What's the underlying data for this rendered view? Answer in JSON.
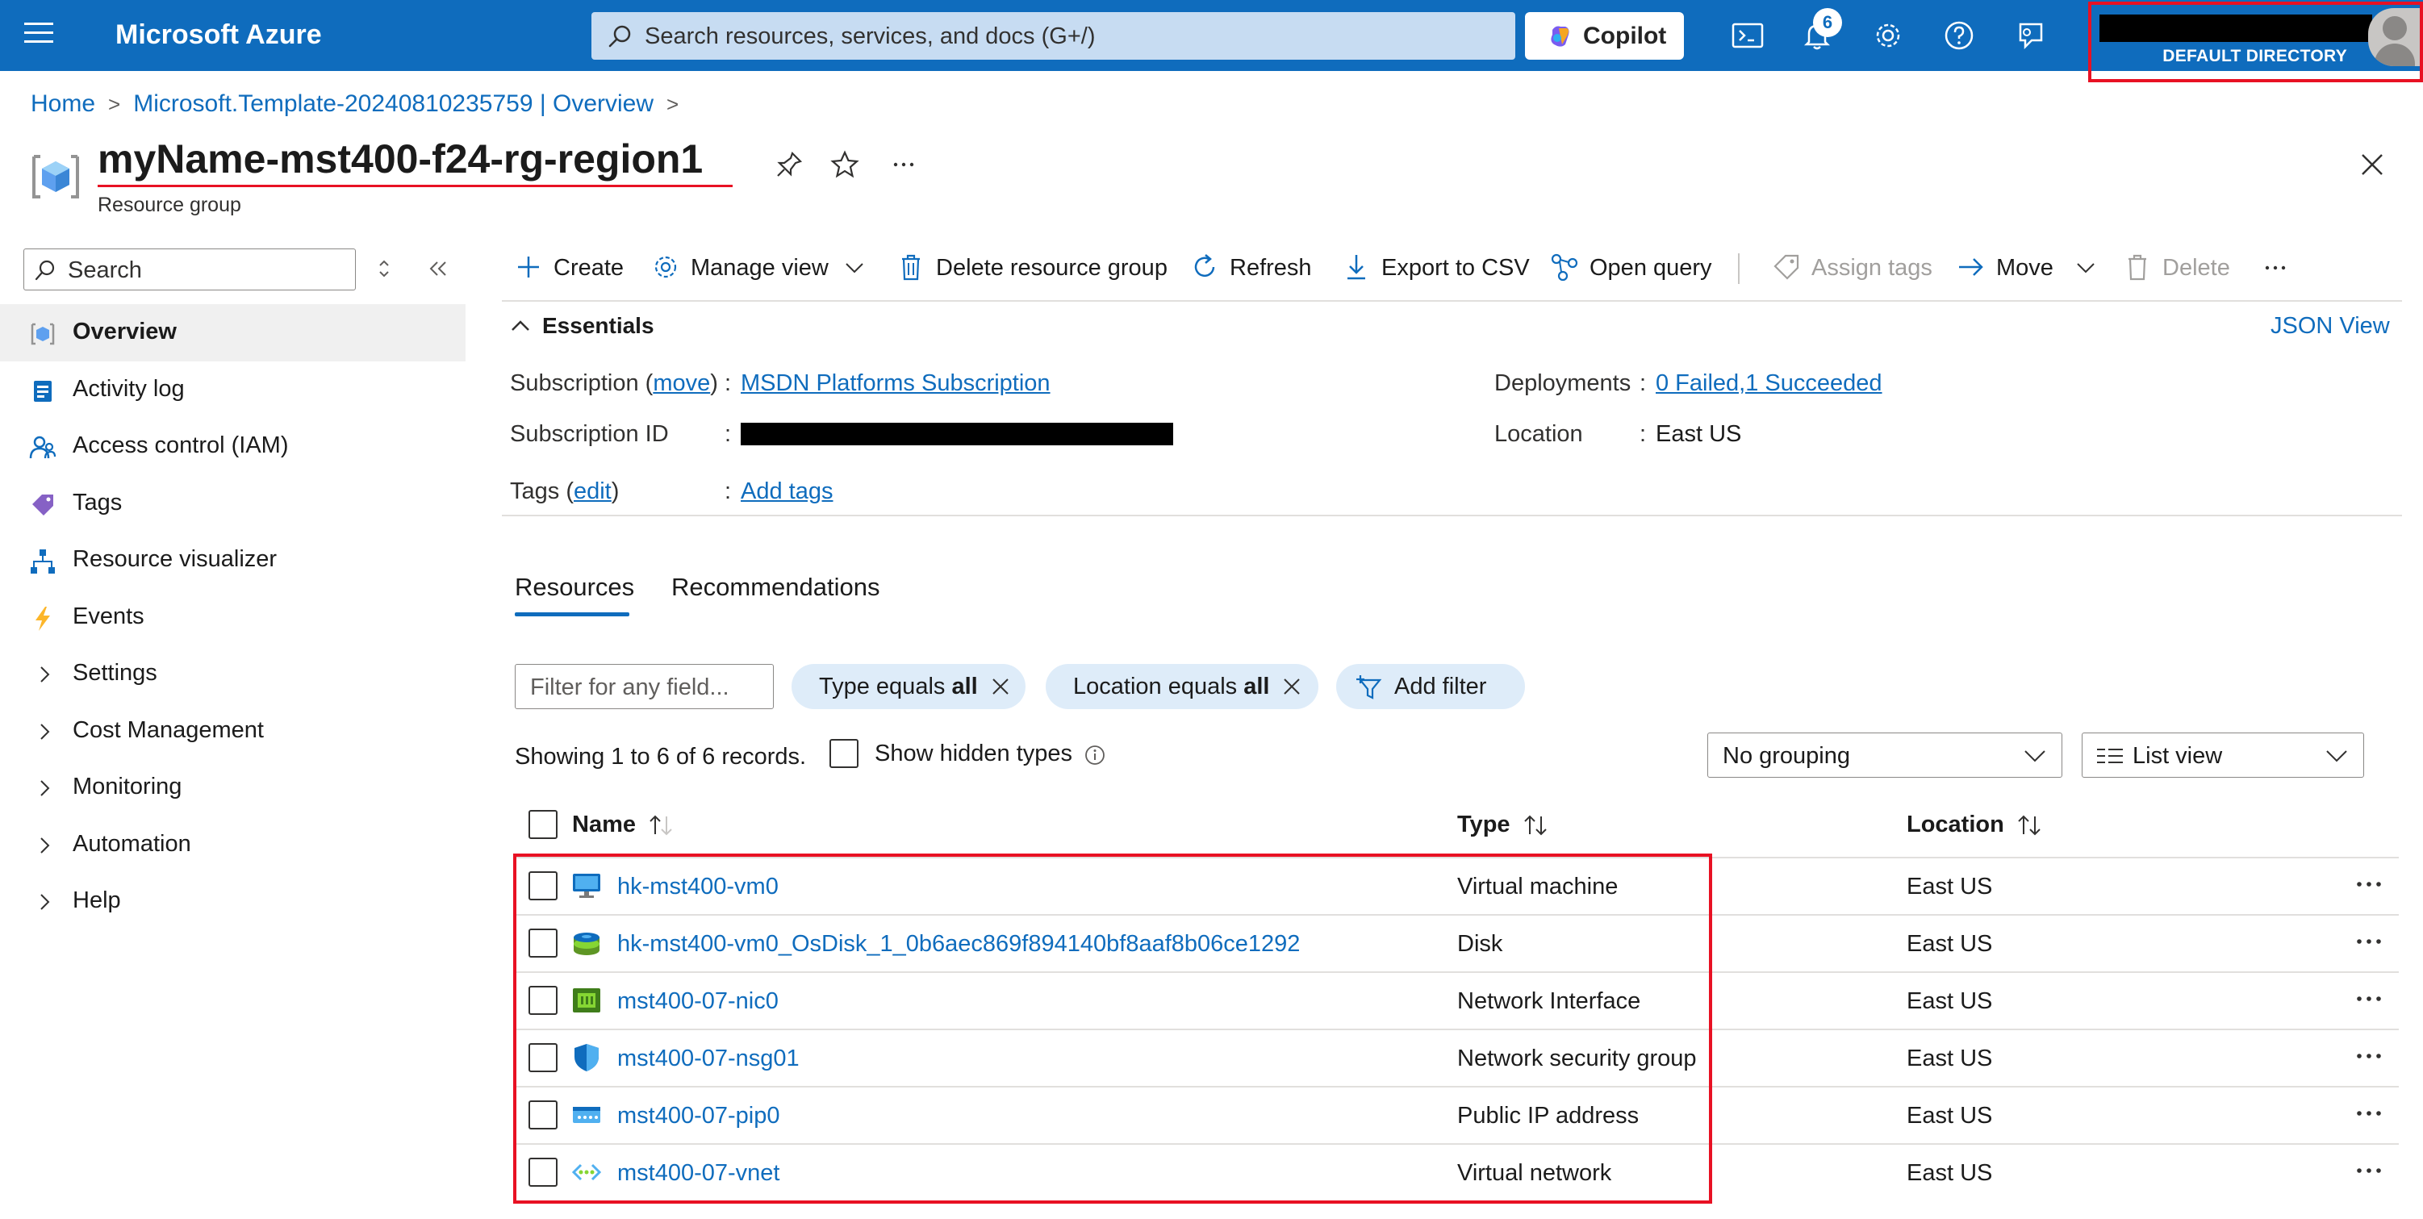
{
  "topbar": {
    "brand": "Microsoft Azure",
    "search_placeholder": "Search resources, services, and docs (G+/)",
    "copilot_label": "Copilot",
    "notification_count": "6",
    "directory_label": "DEFAULT DIRECTORY"
  },
  "breadcrumb": {
    "items": [
      "Home",
      "Microsoft.Template-20240810235759 | Overview"
    ]
  },
  "header": {
    "title": "myName-mst400-f24-rg-region1",
    "subtitle": "Resource group"
  },
  "sidebar": {
    "search_placeholder": "Search",
    "items": [
      {
        "label": "Overview",
        "icon": "resource-group-icon",
        "active": true
      },
      {
        "label": "Activity log",
        "icon": "activity-log-icon"
      },
      {
        "label": "Access control (IAM)",
        "icon": "iam-icon"
      },
      {
        "label": "Tags",
        "icon": "tag-icon"
      },
      {
        "label": "Resource visualizer",
        "icon": "visualizer-icon"
      },
      {
        "label": "Events",
        "icon": "lightning-icon"
      },
      {
        "label": "Settings",
        "icon": "chevron-right-icon"
      },
      {
        "label": "Cost Management",
        "icon": "chevron-right-icon"
      },
      {
        "label": "Monitoring",
        "icon": "chevron-right-icon"
      },
      {
        "label": "Automation",
        "icon": "chevron-right-icon"
      },
      {
        "label": "Help",
        "icon": "chevron-right-icon"
      }
    ]
  },
  "toolbar": {
    "create": "Create",
    "manage_view": "Manage view",
    "delete_rg": "Delete resource group",
    "refresh": "Refresh",
    "export_csv": "Export to CSV",
    "open_query": "Open query",
    "assign_tags": "Assign tags",
    "move": "Move",
    "delete": "Delete"
  },
  "essentials": {
    "heading": "Essentials",
    "json_view": "JSON View",
    "subscription_label": "Subscription",
    "subscription_move": "move",
    "subscription_value": "MSDN Platforms Subscription",
    "subscription_id_label": "Subscription ID",
    "tags_label": "Tags",
    "tags_edit": "edit",
    "tags_value": "Add tags",
    "deployments_label": "Deployments",
    "deployments_value": "0 Failed,1 Succeeded",
    "location_label": "Location",
    "location_value": "East US"
  },
  "tabs": [
    "Resources",
    "Recommendations"
  ],
  "filters": {
    "placeholder": "Filter for any field...",
    "type_prefix": "Type equals ",
    "type_value": "all",
    "location_prefix": "Location equals ",
    "location_value": "all",
    "add_filter": "Add filter",
    "showing": "Showing 1 to 6 of 6 records.",
    "show_hidden": "Show hidden types",
    "grouping": "No grouping",
    "view": "List view"
  },
  "table": {
    "columns": [
      "Name",
      "Type",
      "Location"
    ],
    "rows": [
      {
        "name": "hk-mst400-vm0",
        "type": "Virtual machine",
        "location": "East US",
        "icon": "virtual-machine-icon"
      },
      {
        "name": "hk-mst400-vm0_OsDisk_1_0b6aec869f894140bf8aaf8b06ce1292",
        "type": "Disk",
        "location": "East US",
        "icon": "disk-icon"
      },
      {
        "name": "mst400-07-nic0",
        "type": "Network Interface",
        "location": "East US",
        "icon": "network-interface-icon"
      },
      {
        "name": "mst400-07-nsg01",
        "type": "Network security group",
        "location": "East US",
        "icon": "shield-icon"
      },
      {
        "name": "mst400-07-pip0",
        "type": "Public IP address",
        "location": "East US",
        "icon": "public-ip-icon"
      },
      {
        "name": "mst400-07-vnet",
        "type": "Virtual network",
        "location": "East US",
        "icon": "vnet-icon"
      }
    ]
  },
  "colors": {
    "accent": "#0f6cbd",
    "highlight": "#e81123"
  }
}
